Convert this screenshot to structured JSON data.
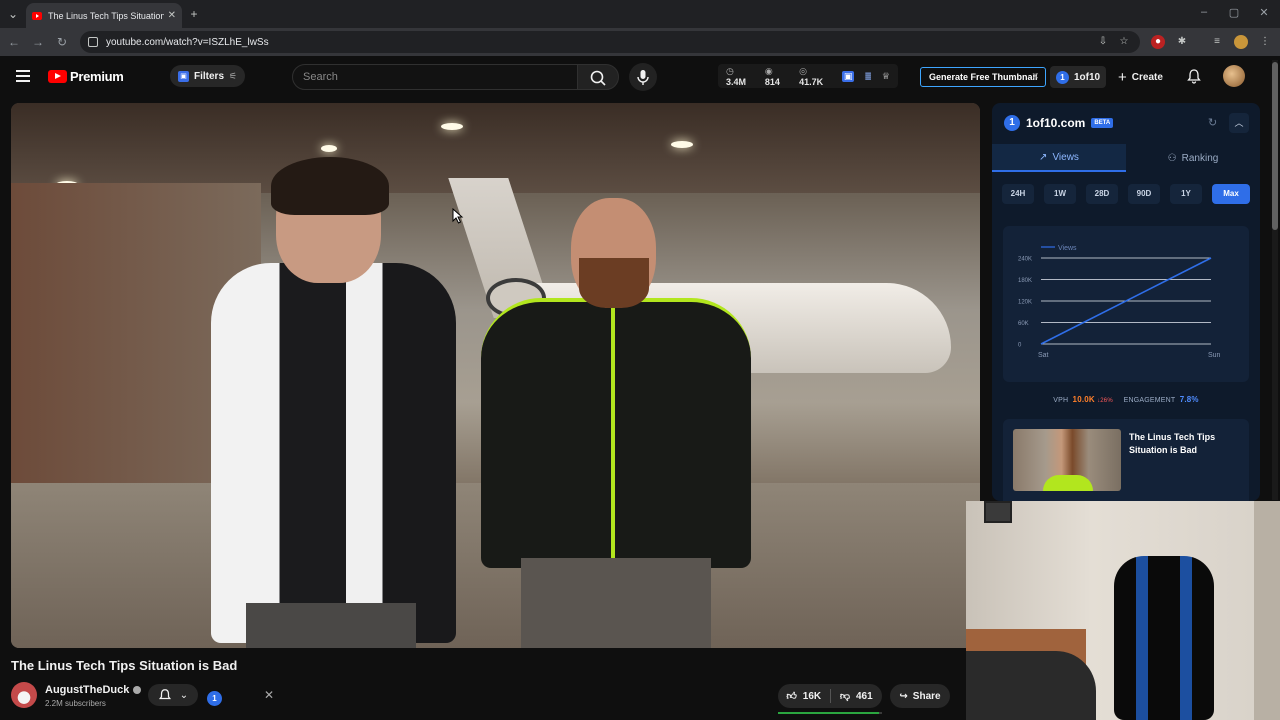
{
  "browser": {
    "tab_title": "The Linus Tech Tips Situation is",
    "new_tab": "+",
    "url": "youtube.com/watch?v=ISZLhE_lwSs"
  },
  "header": {
    "logo_text": "Premium",
    "filters_label": "Filters",
    "search_placeholder": "Search",
    "stats": {
      "subs": "3.4M",
      "views": "814",
      "watch": "41.7K"
    },
    "generate_thumbnail": "Generate Free Thumbnail",
    "oneof10_button": "1of10",
    "oneof10_badge": "1",
    "create_label": "Create"
  },
  "video": {
    "title": "The Linus Tech Tips Situation is Bad",
    "channel_name": "AugustTheDuck",
    "subscribers": "2.2M subscribers",
    "ext_badge": "1",
    "likes": "16K",
    "dislikes": "461",
    "like_ratio": 0.97,
    "share_label": "Share"
  },
  "panel": {
    "logo": "1",
    "name": "1of10.com",
    "beta": "BETA",
    "tabs": [
      {
        "label": "Views",
        "icon": "trend-icon"
      },
      {
        "label": "Ranking",
        "icon": "user-icon"
      }
    ],
    "ranges": [
      "24H",
      "1W",
      "28D",
      "90D",
      "1Y",
      "Max"
    ],
    "active_range": "Max",
    "vph_label": "VPH",
    "vph_value": "10.0K",
    "vph_change": "↓26%",
    "engagement_label": "ENGAGEMENT",
    "engagement_value": "7.8%",
    "card_title": "The Linus Tech Tips Situation is Bad"
  },
  "chart_data": {
    "type": "line",
    "x": [
      "Sat",
      "Sun"
    ],
    "series": [
      {
        "name": "Views",
        "values": [
          0,
          240000
        ]
      }
    ],
    "yticks": [
      "240K",
      "180K",
      "120K",
      "60K",
      "0"
    ],
    "ylim": [
      0,
      240000
    ],
    "grid": true,
    "legend_position": "top-left",
    "color": "#2f6ee8"
  }
}
